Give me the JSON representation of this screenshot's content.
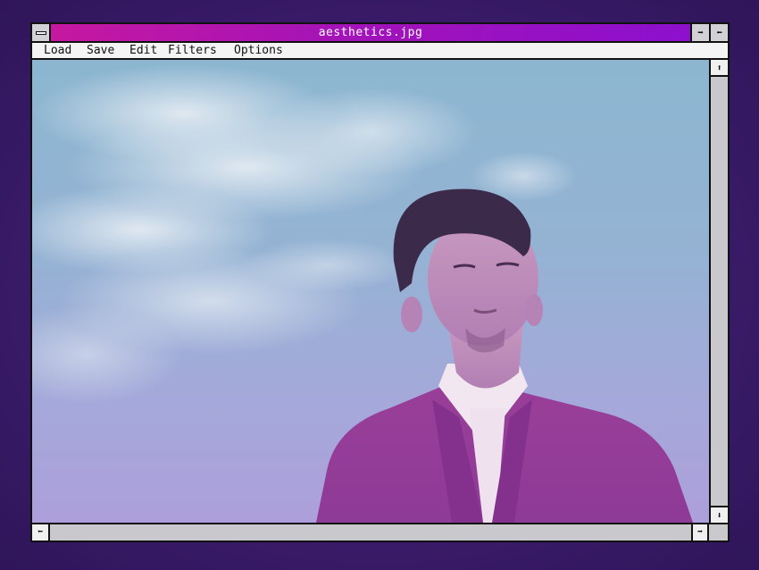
{
  "window": {
    "title": "aesthetics.jpg"
  },
  "menu": {
    "items": [
      "Load",
      "Save",
      "Edit",
      "Filters",
      "Options"
    ]
  },
  "icons": {
    "system_menu": "minus-box-icon",
    "title_right": "arrow-right-icon",
    "title_left": "arrow-left-icon",
    "scroll_up": "arrow-up-icon",
    "scroll_down": "arrow-down-icon",
    "scroll_left": "arrow-left-icon",
    "scroll_right": "arrow-right-icon"
  },
  "colors": {
    "background": "#3b1c6b",
    "title_gradient_start": "#c8189f",
    "title_gradient_end": "#8a0fd0",
    "window_frame": "#c9c9cd",
    "menubar": "#f4f4f4"
  }
}
